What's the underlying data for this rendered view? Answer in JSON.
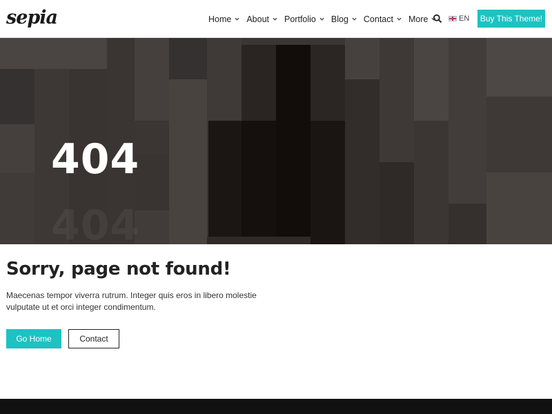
{
  "header": {
    "logo": "sepia",
    "nav": [
      {
        "label": "Home",
        "icon": "chevron-down-icon"
      },
      {
        "label": "About",
        "icon": "chevron-down-icon"
      },
      {
        "label": "Portfolio",
        "icon": "chevron-down-icon"
      },
      {
        "label": "Blog",
        "icon": "chevron-down-icon"
      },
      {
        "label": "Contact",
        "icon": "chevron-down-icon"
      },
      {
        "label": "More",
        "icon": "chevron-down-icon"
      }
    ],
    "search_icon": "search-icon",
    "language": "EN",
    "flag_icon": "uk-flag-icon",
    "buy_label": "Buy This Theme!"
  },
  "hero": {
    "code": "404",
    "ghost_code": "404"
  },
  "main": {
    "title": "Sorry, page not found!",
    "description": "Maecenas tempor viverra rutrum. Integer quis eros in libero molestie vulputate ut et orci integer condimentum.",
    "home_button": "Go Home",
    "contact_button": "Contact"
  },
  "colors": {
    "accent": "#1ec2c2",
    "hero_bg": "#3a3532",
    "footer": "#111111"
  }
}
